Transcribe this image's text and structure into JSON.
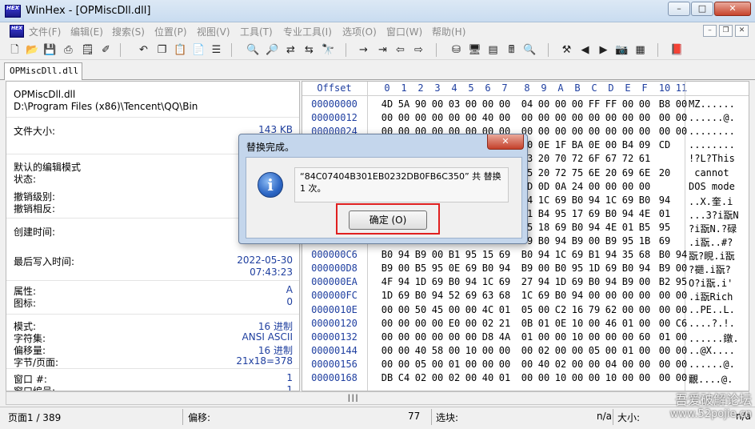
{
  "window": {
    "title": "WinHex - [OPMiscDll.dll]",
    "logo": "HEX",
    "minimize_icon": "minimize-icon",
    "maximize_icon": "maximize-icon",
    "close_icon": "close-icon"
  },
  "menu": [
    "文件(F)",
    "编辑(E)",
    "搜索(S)",
    "位置(P)",
    "视图(V)",
    "工具(T)",
    "专业工具(I)",
    "选项(O)",
    "窗口(W)",
    "帮助(H)"
  ],
  "tab": {
    "label": "OPMiscDll.dll"
  },
  "info": {
    "file_name": "OPMiscDll.dll",
    "path": "D:\\Program Files (x86)\\Tencent\\QQ\\Bin",
    "size_label": "文件大小:",
    "size_value": "143 KB",
    "edit_mode_label": "默认的编辑模式",
    "state_label": "状态:",
    "undo_level_label": "撤销级别:",
    "undo_reverse_label": "撤销相反:",
    "created_label": "创建时间:",
    "last_write_label": "最后写入时间:",
    "last_write_date": "2022-05-30",
    "last_write_time": "07:43:23",
    "attr_label": "属性:",
    "attr_value": "A",
    "icon_label": "图标:",
    "icon_value": "0",
    "mode_label": "模式:",
    "mode_value": "16 进制",
    "charset_label": "字符集:",
    "charset_value": "ANSI ASCII",
    "offset_label": "偏移量:",
    "offset_value": "16 进制",
    "bytes_per_page_label": "字节/页面:",
    "bytes_per_page_value": "21x18=378",
    "window_no_label": "窗口 #:",
    "window_no_value": "1",
    "window_count_label": "窗口编号:",
    "window_count_value": "1"
  },
  "hex": {
    "offset_header": "Offset",
    "columns": [
      "0",
      "1",
      "2",
      "3",
      "4",
      "5",
      "6",
      "7",
      "8",
      "9",
      "A",
      "B",
      "C",
      "D",
      "E",
      "F",
      "10",
      "11"
    ],
    "rows": [
      {
        "offset": "00000000",
        "bytes": [
          "4D",
          "5A",
          "90",
          "00",
          "03",
          "00",
          "00",
          "00",
          "04",
          "00",
          "00",
          "00",
          "FF",
          "FF",
          "00",
          "00",
          "B8",
          "00"
        ],
        "ascii": "MZ......"
      },
      {
        "offset": "00000012",
        "bytes": [
          "00",
          "00",
          "00",
          "00",
          "00",
          "00",
          "40",
          "00",
          "00",
          "00",
          "00",
          "00",
          "00",
          "00",
          "00",
          "00",
          "00",
          "00"
        ],
        "ascii": "......@."
      },
      {
        "offset": "00000024",
        "bytes": [
          "00",
          "00",
          "00",
          "00",
          "00",
          "00",
          "00",
          "00",
          "00",
          "00",
          "00",
          "00",
          "00",
          "00",
          "00",
          "00",
          "00",
          "00"
        ],
        "ascii": "........"
      },
      {
        "offset": "",
        "bytes": [
          "",
          "",
          "",
          "",
          "",
          "",
          "",
          "",
          "00",
          "0E",
          "1F",
          "BA",
          "0E",
          "00",
          "B4",
          "09",
          "CD"
        ],
        "ascii": "........"
      },
      {
        "offset": "",
        "bytes": [
          "",
          "",
          "",
          "",
          "",
          "",
          "",
          "",
          "73",
          "20",
          "70",
          "72",
          "6F",
          "67",
          "72",
          "61"
        ],
        "ascii": "!?L?This"
      },
      {
        "offset": "",
        "bytes": [
          "",
          "",
          "",
          "",
          "",
          "",
          "",
          "",
          "65",
          "20",
          "72",
          "75",
          "6E",
          "20",
          "69",
          "6E",
          "20"
        ],
        "ascii": " cannot "
      },
      {
        "offset": "",
        "bytes": [
          "",
          "",
          "",
          "",
          "",
          "",
          "",
          "",
          "0D",
          "0D",
          "0A",
          "24",
          "00",
          "00",
          "00",
          "00"
        ],
        "ascii": "DOS mode"
      },
      {
        "offset": "",
        "bytes": [
          "",
          "",
          "",
          "",
          "",
          "",
          "",
          "",
          "94",
          "1C",
          "69",
          "B0",
          "94",
          "1C",
          "69",
          "B0",
          "94"
        ],
        "ascii": "..X.奎.i"
      },
      {
        "offset": "",
        "bytes": [
          "",
          "",
          "",
          "",
          "",
          "",
          "",
          "",
          "01",
          "B4",
          "95",
          "17",
          "69",
          "B0",
          "94",
          "4E",
          "01"
        ],
        "ascii": "...3?i翫N"
      },
      {
        "offset": "",
        "bytes": [
          "",
          "",
          "",
          "",
          "",
          "",
          "",
          "",
          "95",
          "18",
          "69",
          "B0",
          "94",
          "4E",
          "01",
          "B5",
          "95"
        ],
        "ascii": "?i翫N.?碌"
      },
      {
        "offset": "",
        "bytes": [
          "",
          "",
          "",
          "",
          "",
          "",
          "",
          "",
          "69",
          "B0",
          "94",
          "B9",
          "00",
          "B9",
          "95",
          "1B",
          "69"
        ],
        "ascii": ".i翫..#?"
      },
      {
        "offset": "000000C6",
        "bytes": [
          "B0",
          "94",
          "B9",
          "00",
          "B1",
          "95",
          "15",
          "69",
          "B0",
          "94",
          "1C",
          "69",
          "B1",
          "94",
          "35",
          "68",
          "B0",
          "94"
        ],
        "ascii": "翫?睍.i翫"
      },
      {
        "offset": "000000D8",
        "bytes": [
          "B9",
          "00",
          "B5",
          "95",
          "0E",
          "69",
          "B0",
          "94",
          "B9",
          "00",
          "B0",
          "95",
          "1D",
          "69",
          "B0",
          "94",
          "B9",
          "00"
        ],
        "ascii": "?禵.i翫?"
      },
      {
        "offset": "000000EA",
        "bytes": [
          "4F",
          "94",
          "1D",
          "69",
          "B0",
          "94",
          "1C",
          "69",
          "27",
          "94",
          "1D",
          "69",
          "B0",
          "94",
          "B9",
          "00",
          "B2",
          "95"
        ],
        "ascii": "O?i翫.i'"
      },
      {
        "offset": "000000FC",
        "bytes": [
          "1D",
          "69",
          "B0",
          "94",
          "52",
          "69",
          "63",
          "68",
          "1C",
          "69",
          "B0",
          "94",
          "00",
          "00",
          "00",
          "00",
          "00",
          "00"
        ],
        "ascii": ".i翫Rich"
      },
      {
        "offset": "0000010E",
        "bytes": [
          "00",
          "00",
          "50",
          "45",
          "00",
          "00",
          "4C",
          "01",
          "05",
          "00",
          "C2",
          "16",
          "79",
          "62",
          "00",
          "00",
          "00",
          "00"
        ],
        "ascii": "..PE..L."
      },
      {
        "offset": "00000120",
        "bytes": [
          "00",
          "00",
          "00",
          "00",
          "E0",
          "00",
          "02",
          "21",
          "0B",
          "01",
          "0E",
          "10",
          "00",
          "46",
          "01",
          "00",
          "00",
          "C6"
        ],
        "ascii": "....?.!."
      },
      {
        "offset": "00000132",
        "bytes": [
          "00",
          "00",
          "00",
          "00",
          "00",
          "00",
          "D8",
          "4A",
          "01",
          "00",
          "00",
          "10",
          "00",
          "00",
          "00",
          "60",
          "01",
          "00"
        ],
        "ascii": "......鐓."
      },
      {
        "offset": "00000144",
        "bytes": [
          "00",
          "00",
          "40",
          "58",
          "00",
          "10",
          "00",
          "00",
          "00",
          "02",
          "00",
          "00",
          "05",
          "00",
          "01",
          "00",
          "00",
          "00"
        ],
        "ascii": "..@X...."
      },
      {
        "offset": "00000156",
        "bytes": [
          "00",
          "00",
          "05",
          "00",
          "01",
          "00",
          "00",
          "00",
          "00",
          "40",
          "02",
          "00",
          "00",
          "04",
          "00",
          "00",
          "00",
          "00"
        ],
        "ascii": "......@."
      },
      {
        "offset": "00000168",
        "bytes": [
          "DB",
          "C4",
          "02",
          "00",
          "02",
          "00",
          "40",
          "01",
          "00",
          "00",
          "10",
          "00",
          "00",
          "10",
          "00",
          "00",
          "00",
          "00"
        ],
        "ascii": "覼....@."
      }
    ]
  },
  "status": {
    "page": "页面1 / 389",
    "offset_label": "偏移:",
    "offset_value": "77",
    "select_label": "选块:",
    "na1": "n/a",
    "size_label": "大小:",
    "na2": "n/a"
  },
  "watermark": {
    "line1": "吾爱破解论坛",
    "line2": "www.52pojie.cn"
  },
  "dialog": {
    "title": "替换完成。",
    "message": "“84C07404B301EB0232DB0FB6C350” 共 替换 1 次。",
    "ok_label": "确定 (O)",
    "icon": "info-icon"
  }
}
